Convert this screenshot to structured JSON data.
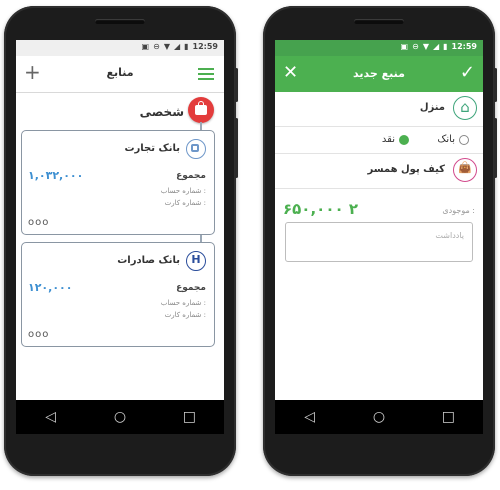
{
  "status_bar": {
    "time": "12:59",
    "icons": [
      "image-icon",
      "dnd-icon",
      "wifi-icon",
      "signal-icon",
      "battery-icon"
    ]
  },
  "left_screen": {
    "title": "منابع",
    "group": {
      "label": "شخصی",
      "icon": "bag-icon",
      "color": "#e33c3c"
    },
    "cards": [
      {
        "name": "بانک تجارت",
        "sum_label": "مجموع",
        "amount": "۱,۰۳۲,۰۰۰",
        "account_label": "شماره حساب :",
        "card_label": "شماره کارت :",
        "more": "ooo"
      },
      {
        "name": "بانک صادرات",
        "sum_label": "مجموع",
        "amount": "۱۲۰,۰۰۰",
        "account_label": "شماره حساب :",
        "card_label": "شماره کارت :",
        "more": "ooo"
      }
    ]
  },
  "right_screen": {
    "title": "منبع جدید",
    "source_name": "منزل",
    "radio": {
      "bank_label": "بانک",
      "cash_label": "نقد",
      "selected": "cash"
    },
    "wallet_name": "کیف پول همسر",
    "balance_label": "موجودی :",
    "balance_value": "۶۵۰,۰۰۰ ٢",
    "note_placeholder": "یادداشت"
  },
  "colors": {
    "accent_green": "#4cb050",
    "amount_blue": "#3d8fd1",
    "group_red": "#e33c3c"
  }
}
